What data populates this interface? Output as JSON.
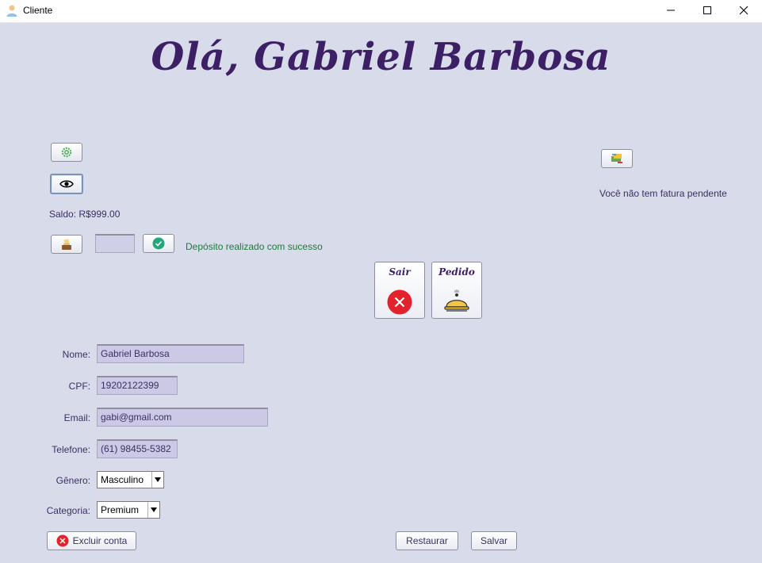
{
  "window": {
    "title": "Cliente"
  },
  "header": {
    "greeting": "Olá, Gabriel Barbosa"
  },
  "balance": {
    "text": "Saldo: R$999.00"
  },
  "deposit": {
    "amount_value": "",
    "status_message": "Depósito realizado com sucesso",
    "status_color": "#1f7a3a"
  },
  "invoice": {
    "message": "Você não tem fatura pendente"
  },
  "actions": {
    "exit_label": "Sair",
    "order_label": "Pedido"
  },
  "form": {
    "name_label": "Nome:",
    "name_value": "Gabriel Barbosa",
    "cpf_label": "CPF:",
    "cpf_value": "19202122399",
    "email_label": "Email:",
    "email_value": "gabi@gmail.com",
    "phone_label": "Telefone:",
    "phone_value": "(61) 98455-5382",
    "gender_label": "Gênero:",
    "gender_value": "Masculino",
    "category_label": "Categoria:",
    "category_value": "Premium"
  },
  "footer": {
    "delete_label": "Excluir conta",
    "restore_label": "Restaurar",
    "save_label": "Salvar"
  },
  "colors": {
    "background": "#d8dbea",
    "title_purple": "#3d1f66",
    "danger_red": "#e3222b"
  }
}
